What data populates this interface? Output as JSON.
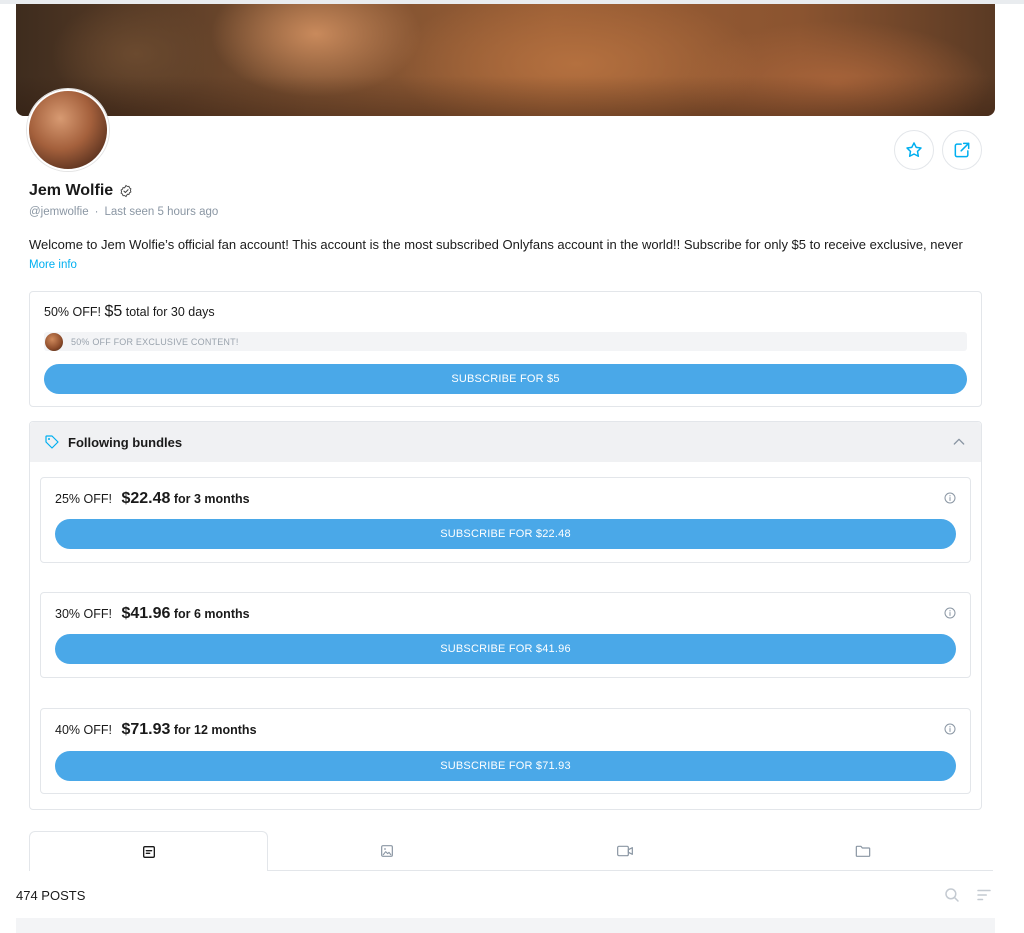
{
  "profile": {
    "name": "Jem Wolfie",
    "handle": "@jemwolfie",
    "separator": "·",
    "last_seen": "Last seen 5 hours ago",
    "bio": "Welcome to Jem Wolfie’s official fan account! This account is the most subscribed Onlyfans account in the world!! Subscribe for only $5 to receive exclusive, never",
    "more_info": "More info"
  },
  "actions": {
    "favorite_icon": "star-icon",
    "share_icon": "share-icon"
  },
  "offer": {
    "discount": "50% OFF!",
    "price": "$5",
    "period": "total for 30 days",
    "promo_text": "50% OFF FOR EXCLUSIVE CONTENT!",
    "button": "SUBSCRIBE FOR $5"
  },
  "bundles": {
    "title": "Following bundles",
    "items": [
      {
        "discount": "25% OFF!",
        "price": "$22.48",
        "period": "for 3 months",
        "button": "SUBSCRIBE FOR $22.48"
      },
      {
        "discount": "30% OFF!",
        "price": "$41.96",
        "period": "for 6 months",
        "button": "SUBSCRIBE FOR $41.96"
      },
      {
        "discount": "40% OFF!",
        "price": "$71.93",
        "period": "for 12 months",
        "button": "SUBSCRIBE FOR $71.93"
      }
    ]
  },
  "tabs": [
    {
      "icon": "posts-icon",
      "active": true
    },
    {
      "icon": "photos-icon",
      "active": false
    },
    {
      "icon": "videos-icon",
      "active": false
    },
    {
      "icon": "folder-icon",
      "active": false
    }
  ],
  "posts": {
    "count_label": "474 POSTS"
  },
  "colors": {
    "accent": "#00aff0",
    "button": "#4aa8e8"
  }
}
